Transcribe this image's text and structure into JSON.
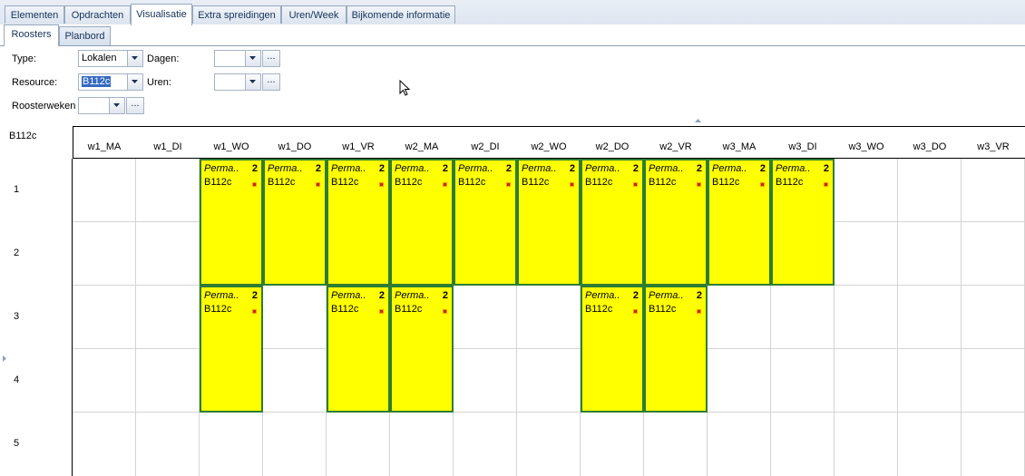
{
  "tabs": [
    "Elementen",
    "Opdrachten",
    "Visualisatie",
    "Extra spreidingen",
    "Uren/Week",
    "Bijkomende informatie"
  ],
  "active_tab": "Visualisatie",
  "subtabs": [
    "Roosters",
    "Planbord"
  ],
  "active_subtab": "Roosters",
  "form": {
    "type_label": "Type:",
    "type_value": "Lokalen",
    "resource_label": "Resource:",
    "resource_value": "B112c",
    "roosterweken_label": "Roosterweken",
    "dagen_label": "Dagen:",
    "uren_label": "Uren:",
    "ellipsis": "..."
  },
  "grid": {
    "resource": "B112c",
    "columns": [
      "w1_MA",
      "w1_DI",
      "w1_WO",
      "w1_DO",
      "w1_VR",
      "w2_MA",
      "w2_DI",
      "w2_WO",
      "w2_DO",
      "w2_VR",
      "w3_MA",
      "w3_DI",
      "w3_WO",
      "w3_DO",
      "w3_VR"
    ],
    "rows": [
      "1",
      "2",
      "3",
      "4",
      "5"
    ],
    "blocks": [
      {
        "col": 2,
        "row": 0,
        "span": 2,
        "title": "Perma..",
        "count": "2",
        "room": "B112c"
      },
      {
        "col": 3,
        "row": 0,
        "span": 2,
        "title": "Perma..",
        "count": "2",
        "room": "B112c"
      },
      {
        "col": 4,
        "row": 0,
        "span": 2,
        "title": "Perma..",
        "count": "2",
        "room": "B112c"
      },
      {
        "col": 5,
        "row": 0,
        "span": 2,
        "title": "Perma..",
        "count": "2",
        "room": "B112c"
      },
      {
        "col": 6,
        "row": 0,
        "span": 2,
        "title": "Perma..",
        "count": "2",
        "room": "B112c"
      },
      {
        "col": 7,
        "row": 0,
        "span": 2,
        "title": "Perma..",
        "count": "2",
        "room": "B112c"
      },
      {
        "col": 8,
        "row": 0,
        "span": 2,
        "title": "Perma..",
        "count": "2",
        "room": "B112c"
      },
      {
        "col": 9,
        "row": 0,
        "span": 2,
        "title": "Perma..",
        "count": "2",
        "room": "B112c"
      },
      {
        "col": 10,
        "row": 0,
        "span": 2,
        "title": "Perma..",
        "count": "2",
        "room": "B112c"
      },
      {
        "col": 11,
        "row": 0,
        "span": 2,
        "title": "Perma..",
        "count": "2",
        "room": "B112c"
      },
      {
        "col": 2,
        "row": 2,
        "span": 2,
        "title": "Perma..",
        "count": "2",
        "room": "B112c"
      },
      {
        "col": 4,
        "row": 2,
        "span": 2,
        "title": "Perma..",
        "count": "2",
        "room": "B112c"
      },
      {
        "col": 5,
        "row": 2,
        "span": 2,
        "title": "Perma..",
        "count": "2",
        "room": "B112c"
      },
      {
        "col": 8,
        "row": 2,
        "span": 2,
        "title": "Perma..",
        "count": "2",
        "room": "B112c"
      },
      {
        "col": 9,
        "row": 2,
        "span": 2,
        "title": "Perma..",
        "count": "2",
        "room": "B112c"
      }
    ]
  },
  "colors": {
    "block_fill": "#ffff00",
    "block_border": "#2e7d32",
    "tab_border": "#98a9c2"
  }
}
